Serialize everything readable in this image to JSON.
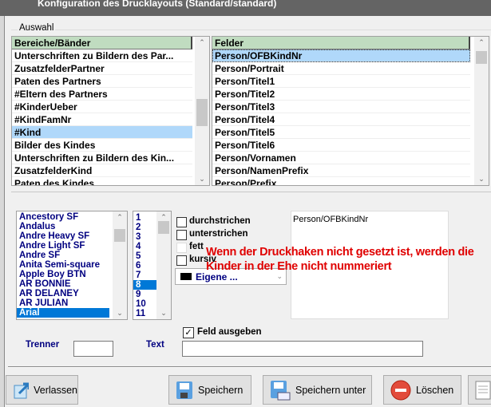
{
  "window": {
    "title": "Konfiguration des Drucklayouts (Standard/standard)"
  },
  "auswahl": {
    "label": "Auswahl",
    "bands": {
      "header": "Bereiche/Bänder",
      "items": [
        "Unterschriften zu Bildern des Par...",
        "ZusatzfelderPartner",
        "Paten des Partners",
        "#Eltern des Partners",
        "#KinderUeber",
        "#KindFamNr",
        "#Kind",
        "Bilder des Kindes",
        "Unterschriften zu Bildern des Kin...",
        "ZusatzfelderKind",
        "Paten des Kindes"
      ],
      "selected": "#Kind"
    },
    "fields": {
      "header": "Felder",
      "items": [
        "Person/OFBKindNr",
        "Person/Portrait",
        "Person/Titel1",
        "Person/Titel2",
        "Person/Titel3",
        "Person/Titel4",
        "Person/Titel5",
        "Person/Titel6",
        "Person/Vornamen",
        "Person/NamenPrefix",
        "Person/Prefix"
      ],
      "selected": "Person/OFBKindNr"
    }
  },
  "format": {
    "fonts": {
      "items": [
        "Ancestory SF",
        "Andalus",
        "Andre Heavy SF",
        "Andre Light SF",
        "Andre SF",
        "Anita  Semi-square",
        "Apple Boy BTN",
        "AR BONNIE",
        "AR DELANEY",
        "AR JULIAN",
        "Arial"
      ],
      "selected": "Arial"
    },
    "sizes": {
      "items": [
        "1",
        "2",
        "3",
        "4",
        "5",
        "6",
        "7",
        "8",
        "9",
        "10",
        "11"
      ],
      "selected": "8"
    },
    "checks": [
      {
        "label": "durchstrichen",
        "checked": false
      },
      {
        "label": "unterstrichen",
        "checked": false
      },
      {
        "label": "fett",
        "checked": false
      },
      {
        "label": "kursiv",
        "checked": false
      }
    ],
    "color": {
      "value": "Eigene ...",
      "swatch": "#000000"
    },
    "preview": "Person/OFBKindNr",
    "note": "Wenn der Druckhaken nicht gesetzt ist, werden die Kinder in der Ehe nicht nummeriert",
    "note_color": "#e00000",
    "feld_ausgeben": {
      "label": "Feld ausgeben",
      "checked": true
    },
    "trenner": {
      "label": "Trenner",
      "value": ""
    },
    "text": {
      "label": "Text",
      "value": ""
    }
  },
  "buttons": {
    "exit": "Verlassen",
    "save": "Speichern",
    "save_as": "Speichern unter",
    "delete": "Löschen"
  }
}
